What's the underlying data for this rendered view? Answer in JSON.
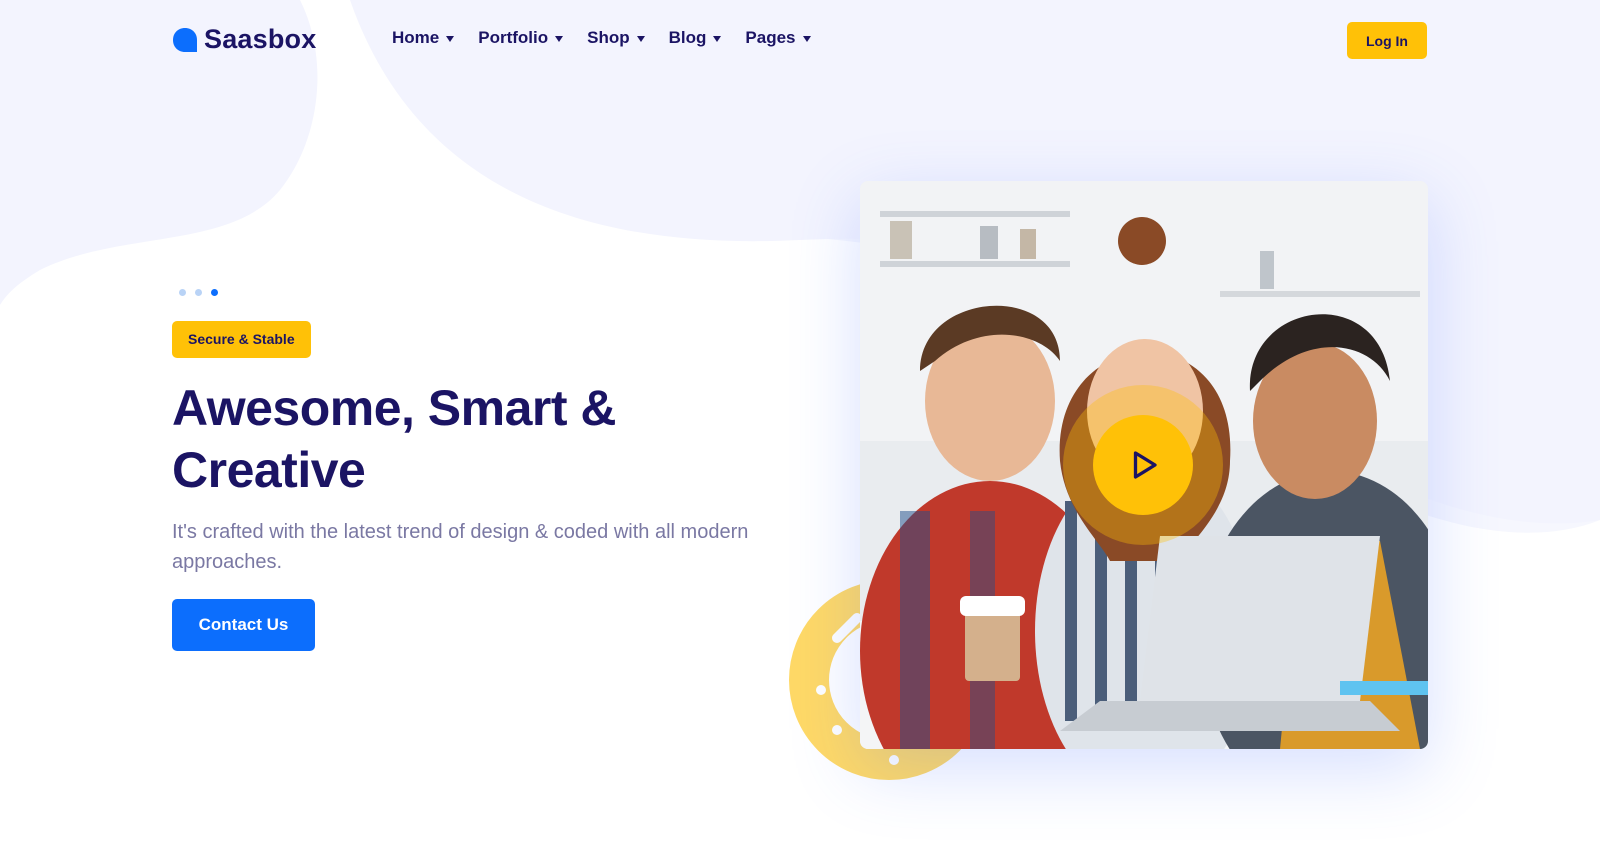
{
  "header": {
    "logo_text": "Saasbox",
    "nav": [
      {
        "label": "Home"
      },
      {
        "label": "Portfolio"
      },
      {
        "label": "Shop"
      },
      {
        "label": "Blog"
      },
      {
        "label": "Pages"
      }
    ],
    "login_label": "Log In"
  },
  "hero": {
    "badge": "Secure & Stable",
    "headline": "Awesome, Smart & Creative",
    "subtext": "It's crafted with the latest trend of design & coded with all modern approaches.",
    "cta_label": "Contact Us",
    "slider": {
      "count": 3,
      "active_index": 2
    }
  },
  "media": {
    "icon": "play-icon"
  },
  "colors": {
    "primary": "#0c6efd",
    "accent": "#ffc107",
    "heading": "#1b1464",
    "body_text": "#7a78a3",
    "background_shape": "#f3f4fe"
  }
}
